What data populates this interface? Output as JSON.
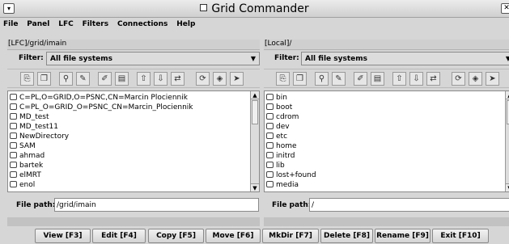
{
  "window": {
    "title": "Grid Commander"
  },
  "menu": [
    "File",
    "Panel",
    "LFC",
    "Filters",
    "Connections",
    "Help"
  ],
  "left_panel": {
    "path": "[LFC]/grid/imain",
    "filter_label": "Filter:",
    "filter_value": "All file systems",
    "files": [
      "C=PL,O=GRID,O=PSNC,CN=Marcin Plociennik",
      "C=PL_O=GRID_O=PSNC_CN=Marcin_Plociennik",
      "MD_test",
      "MD_test11",
      "NewDirectory",
      "SAM",
      "ahmad",
      "bartek",
      "elMRT",
      "enol"
    ],
    "file_path_label": "File path:",
    "file_path_value": "/grid/imain"
  },
  "right_panel": {
    "path": "[Local]/",
    "filter_label": "Filter:",
    "filter_value": "All file systems",
    "files": [
      "bin",
      "boot",
      "cdrom",
      "dev",
      "etc",
      "home",
      "initrd",
      "lib",
      "lost+found",
      "media"
    ],
    "file_path_label": "File path:",
    "file_path_value": "/"
  },
  "toolbar_icons": [
    "new-file-icon",
    "copy-icon",
    "search-icon",
    "edit-icon",
    "rename-icon",
    "properties-icon",
    "upload-icon",
    "download-icon",
    "transfer-icon",
    "refresh-icon",
    "sync-icon",
    "go-icon"
  ],
  "buttons": {
    "view": "View [F3]",
    "edit": "Edit [F4]",
    "copy": "Copy [F5]",
    "move": "Move [F6]",
    "mkdir": "MkDir [F7]",
    "delete": "Delete [F8]",
    "rename": "Rename [F9]",
    "exit": "Exit [F10]"
  }
}
